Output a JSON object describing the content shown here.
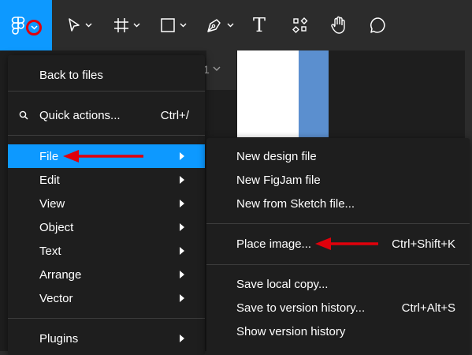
{
  "toolbar": {
    "tools": [
      {
        "name": "main-menu",
        "icon": "figma-logo-icon"
      },
      {
        "name": "move",
        "icon": "move-pointer-icon"
      },
      {
        "name": "frame",
        "icon": "frame-hash-icon"
      },
      {
        "name": "shape",
        "icon": "rectangle-icon"
      },
      {
        "name": "pen",
        "icon": "pen-icon"
      },
      {
        "name": "text",
        "icon": "text-icon"
      },
      {
        "name": "resources",
        "icon": "components-icon"
      },
      {
        "name": "hand",
        "icon": "hand-icon"
      },
      {
        "name": "comment",
        "icon": "comment-icon"
      }
    ],
    "text_tool_glyph": "T"
  },
  "canvas": {
    "property_value": "1"
  },
  "main_menu": {
    "back_to_files": "Back to files",
    "quick_actions": {
      "label": "Quick actions...",
      "shortcut": "Ctrl+/"
    },
    "items": [
      {
        "label": "File"
      },
      {
        "label": "Edit"
      },
      {
        "label": "View"
      },
      {
        "label": "Object"
      },
      {
        "label": "Text"
      },
      {
        "label": "Arrange"
      },
      {
        "label": "Vector"
      }
    ],
    "plugins": "Plugins",
    "selected": "File"
  },
  "file_submenu": {
    "new_design_file": "New design file",
    "new_figjam_file": "New FigJam file",
    "new_from_sketch": "New from Sketch file...",
    "place_image": {
      "label": "Place image...",
      "shortcut": "Ctrl+Shift+K"
    },
    "save_local_copy": "Save local copy...",
    "save_to_version_history": {
      "label": "Save to version history...",
      "shortcut": "Ctrl+Alt+S"
    },
    "show_version_history": "Show version history"
  },
  "colors": {
    "accent": "#0d99ff",
    "menu_bg": "#1e1e1e",
    "toolbar_bg": "#2c2c2c",
    "annotation": "#e0000b"
  }
}
